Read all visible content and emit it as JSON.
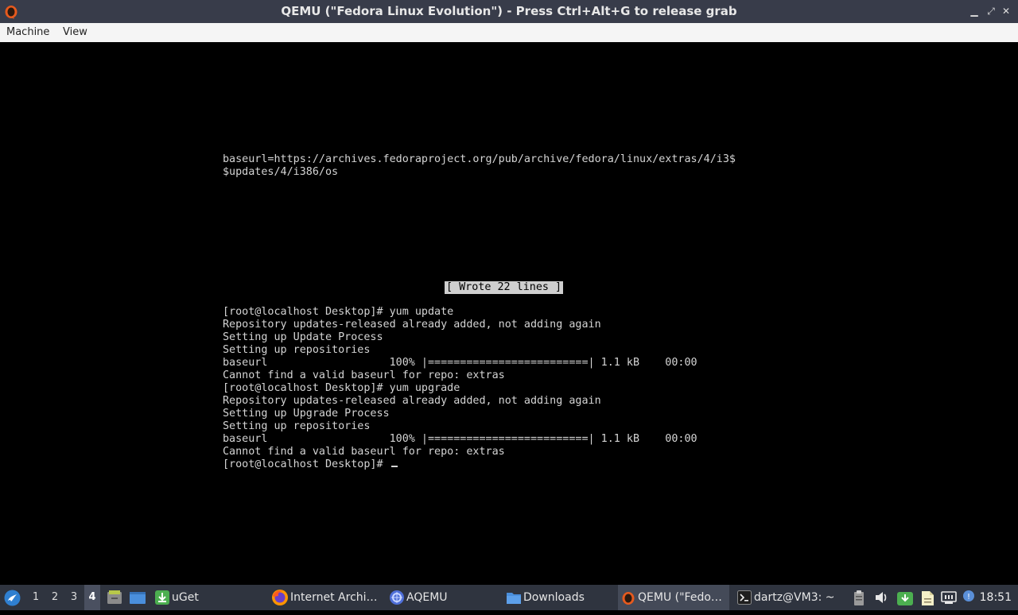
{
  "window": {
    "title": "QEMU (\"Fedora Linux Evolution\") - Press Ctrl+Alt+G to release grab",
    "controls": {
      "minimize": "▁",
      "maximize": "⤢",
      "close": "✕"
    }
  },
  "menubar": {
    "items": [
      "Machine",
      "View"
    ]
  },
  "terminal": {
    "top_lines": [
      "baseurl=https://archives.fedoraproject.org/pub/archive/fedora/linux/extras/4/i3$",
      "$updates/4/i386/os"
    ],
    "status_message": "[ Wrote 22 lines ]",
    "lines": [
      "[root@localhost Desktop]# yum update",
      "Repository updates-released already added, not adding again",
      "Setting up Update Process",
      "Setting up repositories",
      "baseurl                   100% |=========================| 1.1 kB    00:00",
      "Cannot find a valid baseurl for repo: extras",
      "[root@localhost Desktop]# yum upgrade",
      "Repository updates-released already added, not adding again",
      "Setting up Upgrade Process",
      "Setting up repositories",
      "baseurl                   100% |=========================| 1.1 kB    00:00",
      "Cannot find a valid baseurl for repo: extras"
    ],
    "prompt": "[root@localhost Desktop]# "
  },
  "taskbar": {
    "workspaces": [
      "1",
      "2",
      "3",
      "4"
    ],
    "active_workspace": "4",
    "tasks": {
      "uget": "uGet",
      "internet_archive": "Internet Archi…",
      "aqemu": "AQEMU",
      "downloads": "Downloads",
      "qemu": "QEMU (\"Fedo…",
      "terminal": "dartz@VM3: ~"
    },
    "clock": "18:51"
  },
  "colors": {
    "titlebar_bg": "#383c4a",
    "menubar_bg": "#f5f5f5",
    "taskbar_bg": "#2f343f",
    "terminal_fg": "#d4d4d4",
    "terminal_bg": "#000000"
  },
  "icons": [
    "qemu-icon",
    "start-menu-icon",
    "file-manager-icon",
    "show-desktop-icon",
    "uget-icon",
    "firefox-icon",
    "aqemu-icon",
    "folder-icon",
    "terminal-icon",
    "clipboard-icon",
    "volume-icon",
    "uget-tray-icon",
    "notes-icon",
    "network-icon",
    "notification-icon"
  ]
}
